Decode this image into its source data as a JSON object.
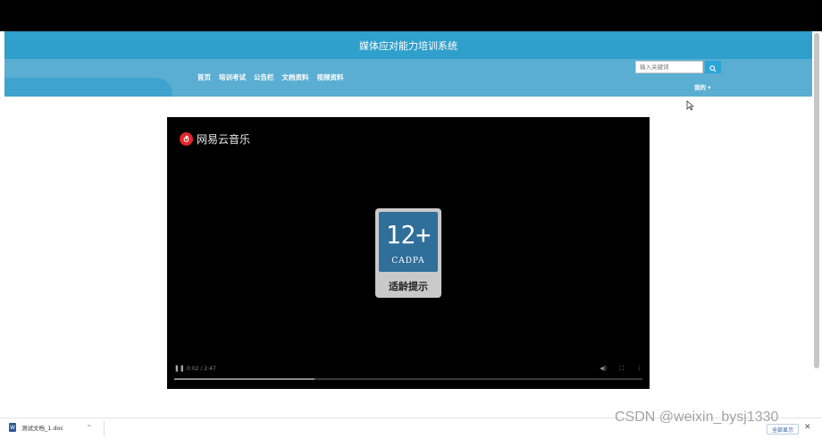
{
  "site": {
    "title": "媒体应对能力培训系统",
    "nav": [
      "首页",
      "培训考试",
      "公告栏",
      "文档资料",
      "视频资料"
    ],
    "search_placeholder": "输入关键词",
    "user_menu": "我的 ▾"
  },
  "video": {
    "brand": "网易云音乐",
    "age_rating": {
      "number": "12+",
      "org": "CADPA",
      "label": "适龄提示"
    },
    "time": "0:02 / 2:47",
    "progress_fraction": 0.3
  },
  "download_bar": {
    "file_name": "测试文档_1.doc",
    "show_all_label": "全部显示",
    "close": "✕"
  },
  "watermark": "CSDN @weixin_bysj1330",
  "colors": {
    "header_title_band": "#2f9fcb",
    "header_nav_band": "#5aaed1",
    "search_button": "#2aa5d8",
    "video_bg": "#000000",
    "age_badge_blue": "#2f6f9a"
  },
  "icons": {
    "search": "search-icon",
    "cursor": "mouse-pointer-icon",
    "play": "pause-icon",
    "volume": "volume-icon",
    "fullscreen": "fullscreen-icon",
    "more": "more-vertical-icon",
    "doc": "word-doc-icon"
  }
}
